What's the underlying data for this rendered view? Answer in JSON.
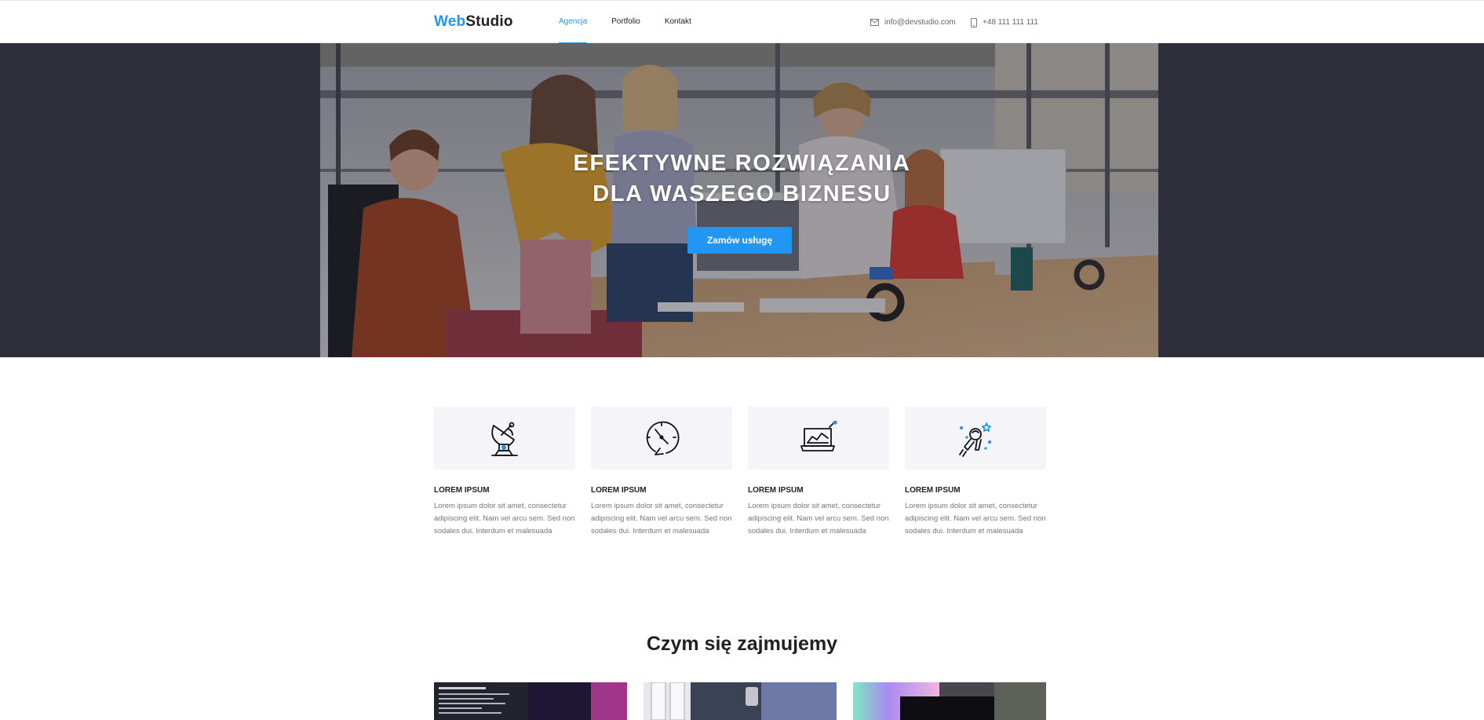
{
  "header": {
    "logo": {
      "part1": "Web",
      "part2": "Studio"
    },
    "nav": [
      {
        "label": "Agencja",
        "active": true
      },
      {
        "label": "Portfolio",
        "active": false
      },
      {
        "label": "Kontakt",
        "active": false
      }
    ],
    "email": "info@devstudio.com",
    "phone": "+48 111 111 111",
    "icons": {
      "email": "mail-icon",
      "phone": "phone-icon"
    }
  },
  "hero": {
    "title_line1": "EFEKTYWNE ROZWIĄZANIA",
    "title_line2": "DLA WASZEGO BIZNESU",
    "button": "Zamów usługę"
  },
  "features": [
    {
      "icon": "satellite-dish-icon",
      "title": "LOREM IPSUM",
      "text": "Lorem ipsum dolor sit amet, consectetur adipiscing elit. Nam vel arcu sem. Sed non sodales dui. Interdum et malesuada"
    },
    {
      "icon": "clock-icon",
      "title": "LOREM IPSUM",
      "text": "Lorem ipsum dolor sit amet, consectetur adipiscing elit. Nam vel arcu sem. Sed non sodales dui. Interdum et malesuada"
    },
    {
      "icon": "laptop-chart-icon",
      "title": "LOREM IPSUM",
      "text": "Lorem ipsum dolor sit amet, consectetur adipiscing elit. Nam vel arcu sem. Sed non sodales dui. Interdum et malesuada"
    },
    {
      "icon": "astronaut-icon",
      "title": "LOREM IPSUM",
      "text": "Lorem ipsum dolor sit amet, consectetur adipiscing elit. Nam vel arcu sem. Sed non sodales dui. Interdum et malesuada"
    }
  ],
  "services": {
    "title": "Czym się zajmujemy"
  },
  "colors": {
    "accent": "#2196f3",
    "hero_bg": "#2e2f3a",
    "feature_bg": "#f4f4f9",
    "text_dark": "#212121",
    "text_muted": "#767676"
  }
}
